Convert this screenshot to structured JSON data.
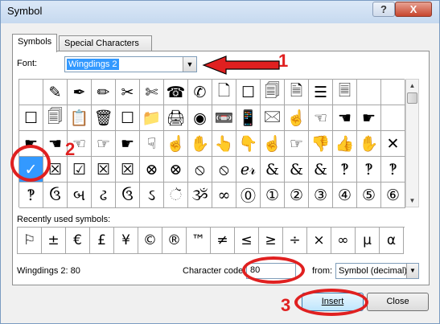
{
  "window": {
    "title": "Symbol",
    "help": "?",
    "close": "X"
  },
  "tabs": [
    {
      "label": "Symbols",
      "active": true
    },
    {
      "label": "Special Characters",
      "active": false
    }
  ],
  "font": {
    "label": "Font:",
    "value": "Wingdings 2"
  },
  "grid": {
    "rows": [
      [
        "",
        "✎",
        "✒",
        "✏",
        "✂",
        "✄",
        "☎",
        "✆",
        "🗋",
        "☐",
        "🗐",
        "🗎",
        "☰",
        "🗏",
        "",
        ""
      ],
      [
        "☐",
        "🗐",
        "📋",
        "🗑",
        "☐",
        "📁",
        "🖨",
        "◉",
        "📼",
        "📱",
        "🖂",
        "☝",
        "☜",
        "☚",
        "☛",
        ""
      ],
      [
        "☛",
        "☚",
        "☜",
        "☞",
        "☛",
        "☟",
        "☝",
        "✋",
        "👆",
        "👇",
        "☝",
        "☞",
        "👎",
        "👍",
        "✋",
        "✕"
      ],
      [
        "✓",
        "☒",
        "☑",
        "☒",
        "☒",
        "⊗",
        "⊗",
        "⦸",
        "⦸",
        "ℯ𝓇",
        "&",
        "&",
        "&",
        "‽",
        "‽",
        "‽"
      ],
      [
        "‽",
        "ઉ",
        "બ",
        "ઢ",
        "ઉ",
        "ઽ",
        "ૅ",
        "ૐ",
        "∞",
        "⓪",
        "①",
        "②",
        "③",
        "④",
        "⑤",
        "⑥"
      ]
    ],
    "selected_row": 3,
    "selected_col": 0
  },
  "recent": {
    "label": "Recently used symbols:",
    "symbols": [
      "⚐",
      "±",
      "€",
      "£",
      "¥",
      "©",
      "®",
      "™",
      "≠",
      "≤",
      "≥",
      "÷",
      "×",
      "∞",
      "µ",
      "α"
    ]
  },
  "status": {
    "char_name": "Wingdings 2: 80",
    "code_label": "Character code:",
    "code_value": "80",
    "from_label": "from:",
    "from_value": "Symbol (decimal)"
  },
  "buttons": {
    "insert": "Insert",
    "cancel": "Close"
  },
  "annotations": {
    "n1": "1",
    "n2": "2",
    "n3": "3",
    "color": "#e02020"
  }
}
